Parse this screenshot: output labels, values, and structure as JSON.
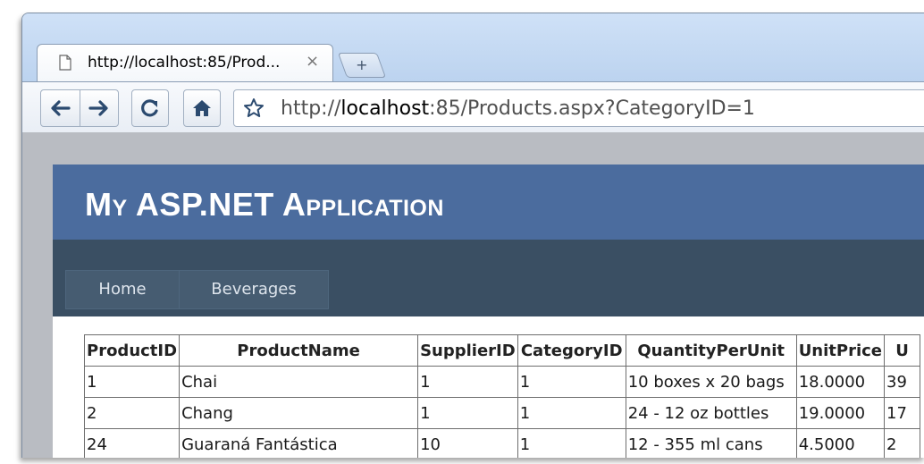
{
  "browser": {
    "tab_title": "http://localhost:85/Prod...",
    "tab_close": "×",
    "new_tab": "+",
    "url_prefix": "http://",
    "url_host": "localhost",
    "url_rest": ":85/Products.aspx?CategoryID=1"
  },
  "app": {
    "title": "My ASP.NET Application",
    "menu": [
      {
        "label": "Home"
      },
      {
        "label": "Beverages"
      }
    ]
  },
  "table": {
    "headers": [
      "ProductID",
      "ProductName",
      "SupplierID",
      "CategoryID",
      "QuantityPerUnit",
      "UnitPrice",
      "U"
    ],
    "rows": [
      [
        "1",
        "Chai",
        "1",
        "1",
        "10 boxes x 20 bags",
        "18.0000",
        "39"
      ],
      [
        "2",
        "Chang",
        "1",
        "1",
        "24 - 12 oz bottles",
        "19.0000",
        "17"
      ],
      [
        "24",
        "Guaraná Fantástica",
        "10",
        "1",
        "12 - 355 ml cans",
        "4.5000",
        "2"
      ]
    ]
  },
  "icons": [
    "page-icon",
    "back-arrow-icon",
    "forward-arrow-icon",
    "reload-icon",
    "home-icon",
    "star-icon"
  ],
  "colors": {
    "header_blue": "#4b6c9e",
    "nav_dark": "#3a4f63",
    "menu_item": "#465c71"
  }
}
